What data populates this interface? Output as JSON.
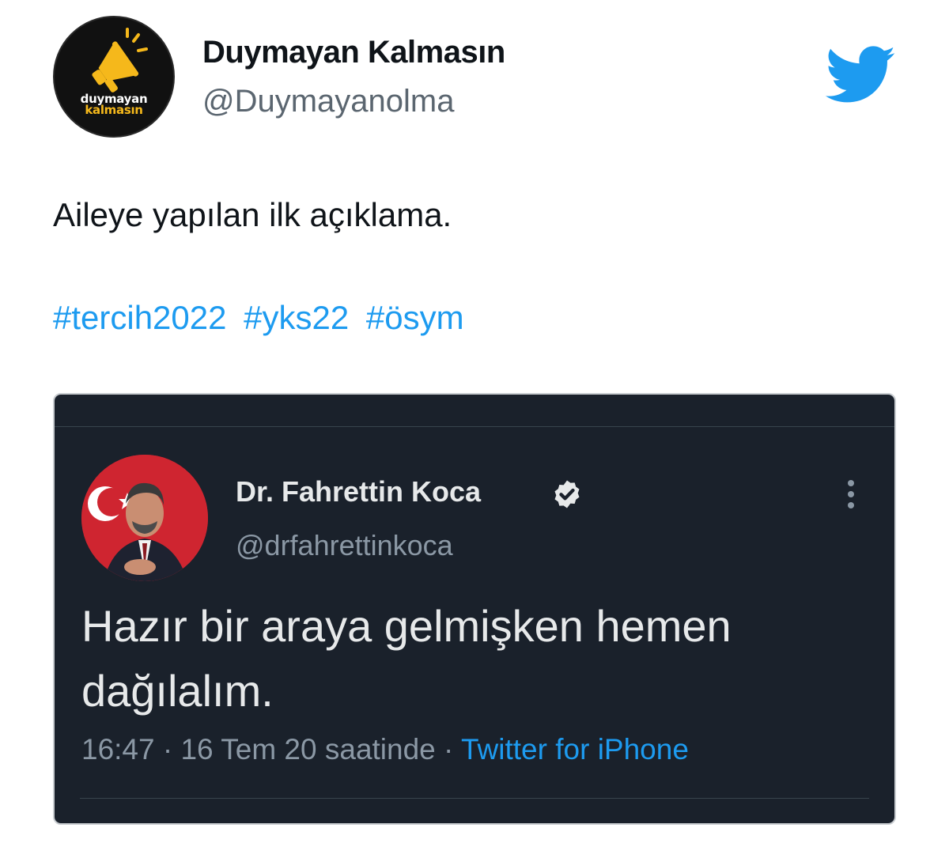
{
  "author": {
    "display_name": "Duymayan Kalmasın",
    "handle": "@Duymayanolma",
    "avatar": {
      "icon": "megaphone-icon",
      "line1": "duymayan",
      "line2": "kalmasın",
      "accent_color": "#f5b81b"
    }
  },
  "tweet": {
    "text": "Aileye yapılan ilk açıklama.",
    "hashtags": [
      "#tercih2022",
      "#yks22",
      "#ösym"
    ]
  },
  "quoted_tweet": {
    "display_name": "Dr. Fahrettin Koca",
    "handle": "@drfahrettinkoca",
    "verified": true,
    "text": "Hazır bir araya gelmişken hemen dağılalım.",
    "time": "16:47",
    "separator": "·",
    "date": "16 Tem 20 saatinde",
    "source": "Twitter for iPhone"
  },
  "colors": {
    "link": "#1d9bf0",
    "embed_background": "#1a212b",
    "brand_twitter": "#1d9bf0"
  }
}
